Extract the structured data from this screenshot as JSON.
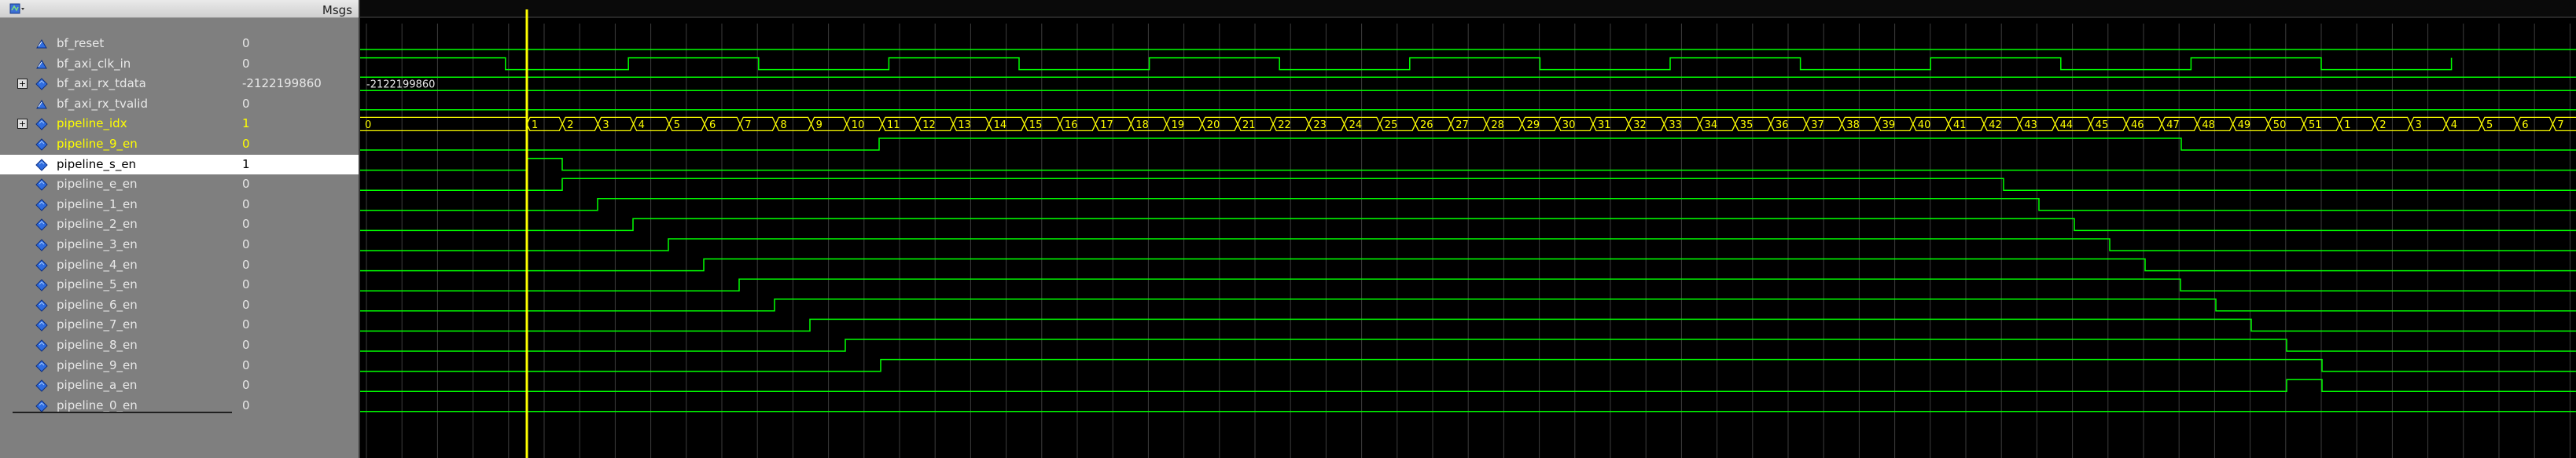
{
  "header": {
    "msgs_label": "Msgs"
  },
  "signals": [
    {
      "name": "bf_reset",
      "value": "0",
      "kind": "bit",
      "expand": false,
      "color": "#e8e8e8"
    },
    {
      "name": "bf_axi_clk_in",
      "value": "0",
      "kind": "bit",
      "expand": false,
      "color": "#e8e8e8"
    },
    {
      "name": "bf_axi_rx_tdata",
      "value": "-2122199860",
      "kind": "bus",
      "expand": true,
      "color": "#e8e8e8"
    },
    {
      "name": "bf_axi_rx_tvalid",
      "value": "0",
      "kind": "bit",
      "expand": false,
      "color": "#e8e8e8"
    },
    {
      "name": "pipeline_idx",
      "value": "1",
      "kind": "bus",
      "expand": true,
      "color": "#ffff00"
    },
    {
      "name": "pipeline_9_en",
      "value": "0",
      "kind": "bit",
      "expand": false,
      "color": "#ffff00"
    },
    {
      "name": "pipeline_s_en",
      "value": "1",
      "kind": "bit",
      "expand": false,
      "color": "#000000",
      "selected": true
    },
    {
      "name": "pipeline_e_en",
      "value": "0",
      "kind": "bit",
      "expand": false,
      "color": "#e8e8e8"
    },
    {
      "name": "pipeline_1_en",
      "value": "0",
      "kind": "bit",
      "expand": false,
      "color": "#e8e8e8"
    },
    {
      "name": "pipeline_2_en",
      "value": "0",
      "kind": "bit",
      "expand": false,
      "color": "#e8e8e8"
    },
    {
      "name": "pipeline_3_en",
      "value": "0",
      "kind": "bit",
      "expand": false,
      "color": "#e8e8e8"
    },
    {
      "name": "pipeline_4_en",
      "value": "0",
      "kind": "bit",
      "expand": false,
      "color": "#e8e8e8"
    },
    {
      "name": "pipeline_5_en",
      "value": "0",
      "kind": "bit",
      "expand": false,
      "color": "#e8e8e8"
    },
    {
      "name": "pipeline_6_en",
      "value": "0",
      "kind": "bit",
      "expand": false,
      "color": "#e8e8e8"
    },
    {
      "name": "pipeline_7_en",
      "value": "0",
      "kind": "bit",
      "expand": false,
      "color": "#e8e8e8"
    },
    {
      "name": "pipeline_8_en",
      "value": "0",
      "kind": "bit",
      "expand": false,
      "color": "#e8e8e8"
    },
    {
      "name": "pipeline_9_en",
      "value": "0",
      "kind": "bit",
      "expand": false,
      "color": "#e8e8e8"
    },
    {
      "name": "pipeline_a_en",
      "value": "0",
      "kind": "bit",
      "expand": false,
      "color": "#e8e8e8"
    },
    {
      "name": "pipeline_0_en",
      "value": "0",
      "kind": "bit",
      "expand": false,
      "color": "#e8e8e8"
    }
  ],
  "waves": {
    "tdata_label": "-2122199860",
    "idx_labels": [
      "0",
      "1",
      "2",
      "3",
      "4",
      "5",
      "6",
      "7",
      "8",
      "9",
      "10",
      "11",
      "12",
      "13",
      "14",
      "15",
      "16",
      "17",
      "18",
      "19",
      "20",
      "21",
      "22",
      "23",
      "24",
      "25",
      "26",
      "27",
      "28",
      "29",
      "30",
      "31",
      "32",
      "33",
      "34",
      "35",
      "36",
      "37",
      "38",
      "39",
      "40",
      "41",
      "42",
      "43",
      "44",
      "45",
      "46",
      "47",
      "48",
      "49",
      "50",
      "51",
      "1",
      "2",
      "3",
      "4",
      "5",
      "6",
      "7"
    ]
  },
  "colors": {
    "wave_green": "#00ff00",
    "cursor_yellow": "#ffff00",
    "bus_yellow": "#ffff00",
    "grid_gray": "#3c3c3c"
  }
}
